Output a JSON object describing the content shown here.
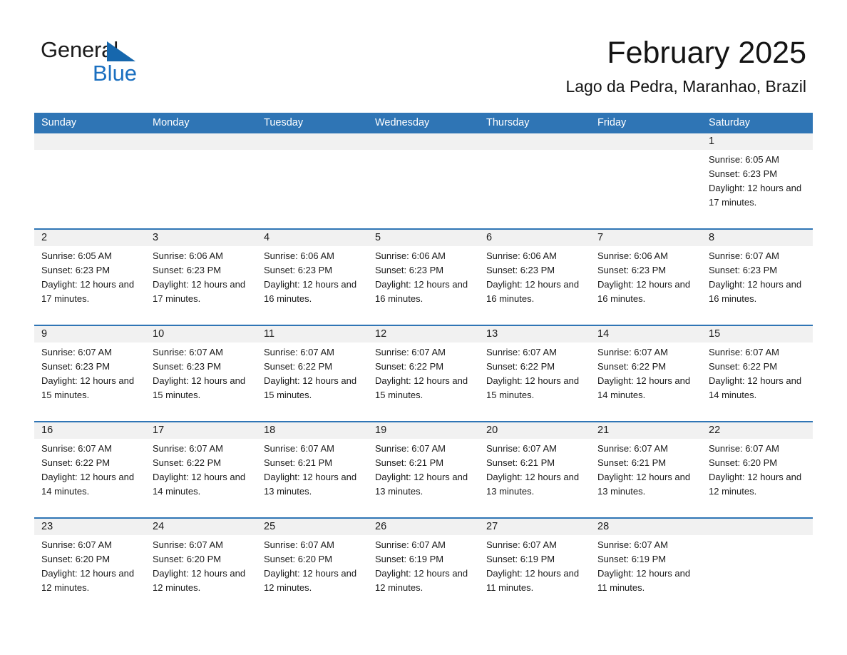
{
  "brand": {
    "line1": "General",
    "line2": "Blue",
    "triangle_color": "#1667ad",
    "blue_color": "#1a6fc0"
  },
  "header": {
    "title": "February 2025",
    "subtitle": "Lago da Pedra, Maranhao, Brazil"
  },
  "theme": {
    "header_blue": "#2f75b5",
    "daynum_band": "#f1f1f1",
    "text": "#1a1a1a"
  },
  "calendar": {
    "weekday_headers": [
      "Sunday",
      "Monday",
      "Tuesday",
      "Wednesday",
      "Thursday",
      "Friday",
      "Saturday"
    ],
    "weeks": [
      [
        {
          "day": "",
          "lines": []
        },
        {
          "day": "",
          "lines": []
        },
        {
          "day": "",
          "lines": []
        },
        {
          "day": "",
          "lines": []
        },
        {
          "day": "",
          "lines": []
        },
        {
          "day": "",
          "lines": []
        },
        {
          "day": "1",
          "sunrise": "Sunrise: 6:05 AM",
          "sunset": "Sunset: 6:23 PM",
          "daylight": "Daylight: 12 hours and 17 minutes."
        }
      ],
      [
        {
          "day": "2",
          "sunrise": "Sunrise: 6:05 AM",
          "sunset": "Sunset: 6:23 PM",
          "daylight": "Daylight: 12 hours and 17 minutes."
        },
        {
          "day": "3",
          "sunrise": "Sunrise: 6:06 AM",
          "sunset": "Sunset: 6:23 PM",
          "daylight": "Daylight: 12 hours and 17 minutes."
        },
        {
          "day": "4",
          "sunrise": "Sunrise: 6:06 AM",
          "sunset": "Sunset: 6:23 PM",
          "daylight": "Daylight: 12 hours and 16 minutes."
        },
        {
          "day": "5",
          "sunrise": "Sunrise: 6:06 AM",
          "sunset": "Sunset: 6:23 PM",
          "daylight": "Daylight: 12 hours and 16 minutes."
        },
        {
          "day": "6",
          "sunrise": "Sunrise: 6:06 AM",
          "sunset": "Sunset: 6:23 PM",
          "daylight": "Daylight: 12 hours and 16 minutes."
        },
        {
          "day": "7",
          "sunrise": "Sunrise: 6:06 AM",
          "sunset": "Sunset: 6:23 PM",
          "daylight": "Daylight: 12 hours and 16 minutes."
        },
        {
          "day": "8",
          "sunrise": "Sunrise: 6:07 AM",
          "sunset": "Sunset: 6:23 PM",
          "daylight": "Daylight: 12 hours and 16 minutes."
        }
      ],
      [
        {
          "day": "9",
          "sunrise": "Sunrise: 6:07 AM",
          "sunset": "Sunset: 6:23 PM",
          "daylight": "Daylight: 12 hours and 15 minutes."
        },
        {
          "day": "10",
          "sunrise": "Sunrise: 6:07 AM",
          "sunset": "Sunset: 6:23 PM",
          "daylight": "Daylight: 12 hours and 15 minutes."
        },
        {
          "day": "11",
          "sunrise": "Sunrise: 6:07 AM",
          "sunset": "Sunset: 6:22 PM",
          "daylight": "Daylight: 12 hours and 15 minutes."
        },
        {
          "day": "12",
          "sunrise": "Sunrise: 6:07 AM",
          "sunset": "Sunset: 6:22 PM",
          "daylight": "Daylight: 12 hours and 15 minutes."
        },
        {
          "day": "13",
          "sunrise": "Sunrise: 6:07 AM",
          "sunset": "Sunset: 6:22 PM",
          "daylight": "Daylight: 12 hours and 15 minutes."
        },
        {
          "day": "14",
          "sunrise": "Sunrise: 6:07 AM",
          "sunset": "Sunset: 6:22 PM",
          "daylight": "Daylight: 12 hours and 14 minutes."
        },
        {
          "day": "15",
          "sunrise": "Sunrise: 6:07 AM",
          "sunset": "Sunset: 6:22 PM",
          "daylight": "Daylight: 12 hours and 14 minutes."
        }
      ],
      [
        {
          "day": "16",
          "sunrise": "Sunrise: 6:07 AM",
          "sunset": "Sunset: 6:22 PM",
          "daylight": "Daylight: 12 hours and 14 minutes."
        },
        {
          "day": "17",
          "sunrise": "Sunrise: 6:07 AM",
          "sunset": "Sunset: 6:22 PM",
          "daylight": "Daylight: 12 hours and 14 minutes."
        },
        {
          "day": "18",
          "sunrise": "Sunrise: 6:07 AM",
          "sunset": "Sunset: 6:21 PM",
          "daylight": "Daylight: 12 hours and 13 minutes."
        },
        {
          "day": "19",
          "sunrise": "Sunrise: 6:07 AM",
          "sunset": "Sunset: 6:21 PM",
          "daylight": "Daylight: 12 hours and 13 minutes."
        },
        {
          "day": "20",
          "sunrise": "Sunrise: 6:07 AM",
          "sunset": "Sunset: 6:21 PM",
          "daylight": "Daylight: 12 hours and 13 minutes."
        },
        {
          "day": "21",
          "sunrise": "Sunrise: 6:07 AM",
          "sunset": "Sunset: 6:21 PM",
          "daylight": "Daylight: 12 hours and 13 minutes."
        },
        {
          "day": "22",
          "sunrise": "Sunrise: 6:07 AM",
          "sunset": "Sunset: 6:20 PM",
          "daylight": "Daylight: 12 hours and 12 minutes."
        }
      ],
      [
        {
          "day": "23",
          "sunrise": "Sunrise: 6:07 AM",
          "sunset": "Sunset: 6:20 PM",
          "daylight": "Daylight: 12 hours and 12 minutes."
        },
        {
          "day": "24",
          "sunrise": "Sunrise: 6:07 AM",
          "sunset": "Sunset: 6:20 PM",
          "daylight": "Daylight: 12 hours and 12 minutes."
        },
        {
          "day": "25",
          "sunrise": "Sunrise: 6:07 AM",
          "sunset": "Sunset: 6:20 PM",
          "daylight": "Daylight: 12 hours and 12 minutes."
        },
        {
          "day": "26",
          "sunrise": "Sunrise: 6:07 AM",
          "sunset": "Sunset: 6:19 PM",
          "daylight": "Daylight: 12 hours and 12 minutes."
        },
        {
          "day": "27",
          "sunrise": "Sunrise: 6:07 AM",
          "sunset": "Sunset: 6:19 PM",
          "daylight": "Daylight: 12 hours and 11 minutes."
        },
        {
          "day": "28",
          "sunrise": "Sunrise: 6:07 AM",
          "sunset": "Sunset: 6:19 PM",
          "daylight": "Daylight: 12 hours and 11 minutes."
        },
        {
          "day": "",
          "lines": []
        }
      ]
    ]
  }
}
